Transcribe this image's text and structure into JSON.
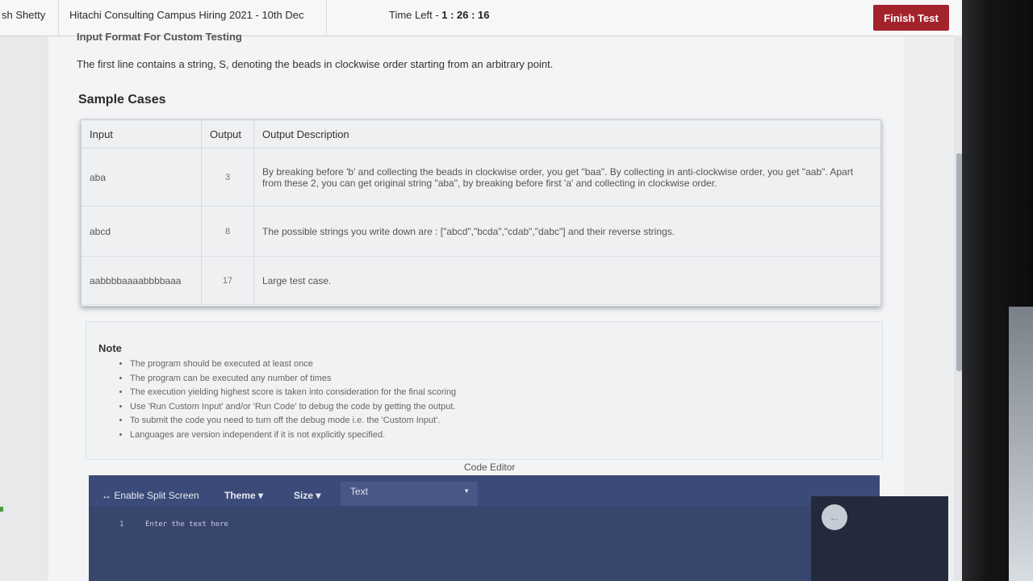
{
  "header": {
    "user_name": "sh Shetty",
    "test_title": "Hitachi Consulting Campus Hiring 2021 - 10th Dec",
    "time_left_label": "Time Left - ",
    "time_left_value": "1 : 26 : 16",
    "finish_label": "Finish Test"
  },
  "problem": {
    "cut_heading": "Input Format For Custom Testing",
    "description": "The first line contains a string, S, denoting the beads in clockwise order starting from an arbitrary point."
  },
  "samples": {
    "title": "Sample Cases",
    "columns": [
      "Input",
      "Output",
      "Output Description"
    ],
    "rows": [
      {
        "input": "aba",
        "output": "3",
        "description": "By breaking before 'b' and collecting the beads in clockwise order, you get \"baa\". By collecting in anti-clockwise order, you get \"aab\". Apart from these 2, you can get original string \"aba\", by breaking before first 'a' and collecting in clockwise order."
      },
      {
        "input": "abcd",
        "output": "8",
        "description": "The possible strings you write down are : [\"abcd\",\"bcda\",\"cdab\",\"dabc\"] and their reverse strings."
      },
      {
        "input": "aabbbbaaaabbbbaaa",
        "output": "17",
        "description": "Large test case."
      }
    ]
  },
  "note": {
    "title": "Note",
    "items": [
      "The program should be executed at least once",
      "The program can be executed any number of times",
      "The execution yielding highest score is taken into consideration for the final scoring",
      "Use 'Run Custom Input' and/or 'Run Code' to debug the code by getting the output.",
      "To submit the code you need to turn off the debug mode i.e. the 'Custom Input'.",
      "Languages are version independent if it is not explicitly specified."
    ]
  },
  "editor": {
    "label": "Code Editor",
    "split_label": "↔ Enable Split Screen",
    "theme_label": "Theme ▾",
    "size_label": "Size ▾",
    "language_value": "Text",
    "line_number": "1",
    "placeholder": "Enter the text here"
  },
  "colors": {
    "finish_button": "#a3232c",
    "editor_background": "#38456d"
  }
}
